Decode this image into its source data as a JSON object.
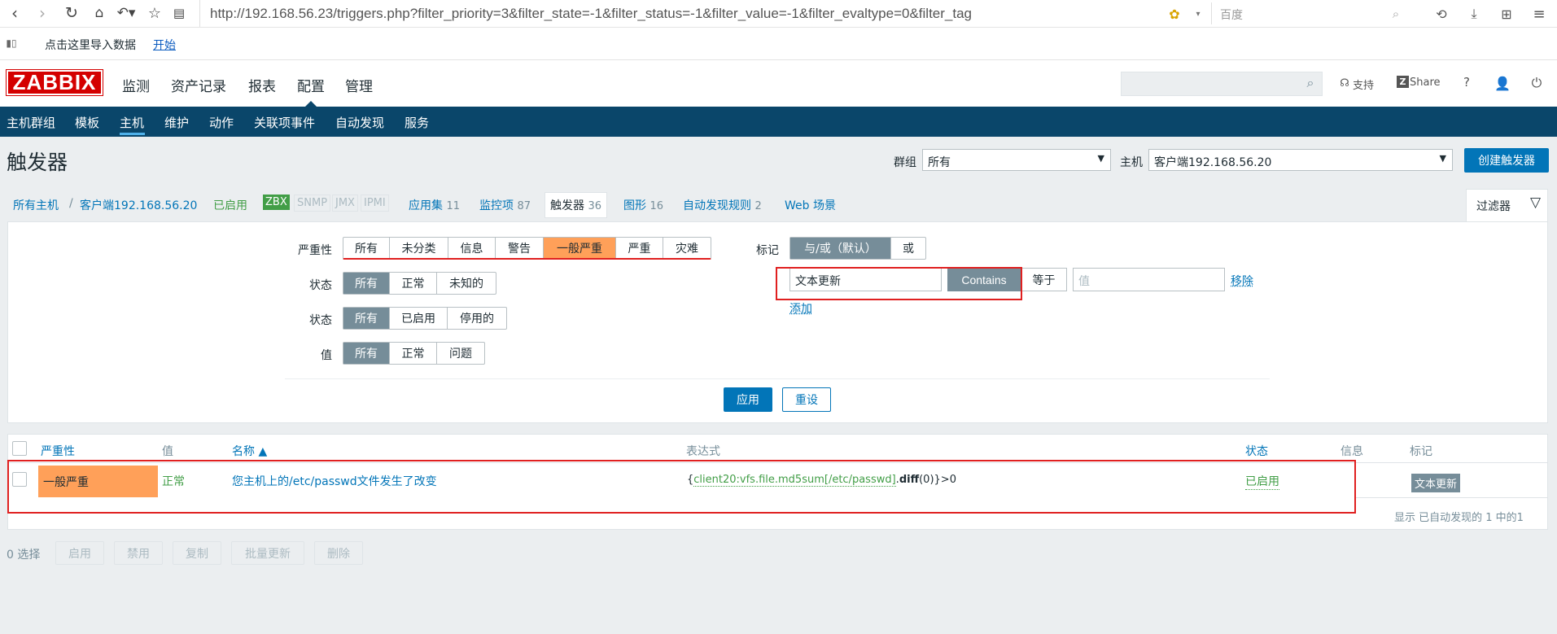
{
  "browser": {
    "url": "http://192.168.56.23/triggers.php?filter_priority=3&filter_state=-1&filter_status=-1&filter_value=-1&filter_evaltype=0&filter_tag",
    "search_placeholder": "百度"
  },
  "bookmarks": {
    "import_text": "点击这里导入数据",
    "start_link": "开始"
  },
  "header": {
    "logo": "ZABBIX",
    "menu": [
      "监测",
      "资产记录",
      "报表",
      "配置",
      "管理"
    ],
    "support": "支持",
    "share": "Share",
    "help": "?"
  },
  "submenu": [
    "主机群组",
    "模板",
    "主机",
    "维护",
    "动作",
    "关联项事件",
    "自动发现",
    "服务"
  ],
  "page": {
    "title": "触发器",
    "group_label": "群组",
    "group_value": "所有",
    "host_label": "主机",
    "host_value": "客户端192.168.56.20",
    "create_button": "创建触发器"
  },
  "breadcrumb": {
    "all_hosts": "所有主机",
    "sep": "/",
    "host": "客户端192.168.56.20",
    "enabled": "已启用",
    "zbx": "ZBX",
    "snmp": "SNMP",
    "jmx": "JMX",
    "ipmi": "IPMI",
    "apps": "应用集",
    "apps_count": "11",
    "items": "监控项",
    "items_count": "87",
    "triggers": "触发器",
    "triggers_count": "36",
    "graphs": "图形",
    "graphs_count": "16",
    "discovery": "自动发现规则",
    "discovery_count": "2",
    "web": "Web 场景",
    "filter_tab": "过滤器"
  },
  "filter": {
    "severity_label": "严重性",
    "severity_options": [
      "所有",
      "未分类",
      "信息",
      "警告",
      "一般严重",
      "严重",
      "灾难"
    ],
    "state_label": "状态",
    "state_options": [
      "所有",
      "正常",
      "未知的"
    ],
    "status_label": "状态",
    "status_options": [
      "所有",
      "已启用",
      "停用的"
    ],
    "value_label": "值",
    "value_options": [
      "所有",
      "正常",
      "问题"
    ],
    "tags_label": "标记",
    "tags_andor": "与/或（默认）",
    "tags_or": "或",
    "tag_name": "文本更新",
    "tag_contains": "Contains",
    "tag_equals": "等于",
    "tag_value_placeholder": "值",
    "remove": "移除",
    "add": "添加",
    "apply": "应用",
    "reset": "重设"
  },
  "table": {
    "headers": {
      "severity": "严重性",
      "value": "值",
      "name": "名称 ▲",
      "expression": "表达式",
      "status": "状态",
      "info": "信息",
      "tags": "标记"
    },
    "row": {
      "severity": "一般严重",
      "value": "正常",
      "name": "您主机上的/etc/passwd文件发生了改变",
      "expr_open": "{",
      "expr_key": "client20:vfs.file.md5sum[/etc/passwd]",
      "expr_dot": ".",
      "expr_func": "diff",
      "expr_rest": "(0)}>0",
      "status": "已启用",
      "tag": "文本更新"
    },
    "summary": "显示 已自动发现的 1 中的1"
  },
  "footer": {
    "selected": "0 选择",
    "buttons": [
      "启用",
      "禁用",
      "复制",
      "批量更新",
      "删除"
    ]
  }
}
